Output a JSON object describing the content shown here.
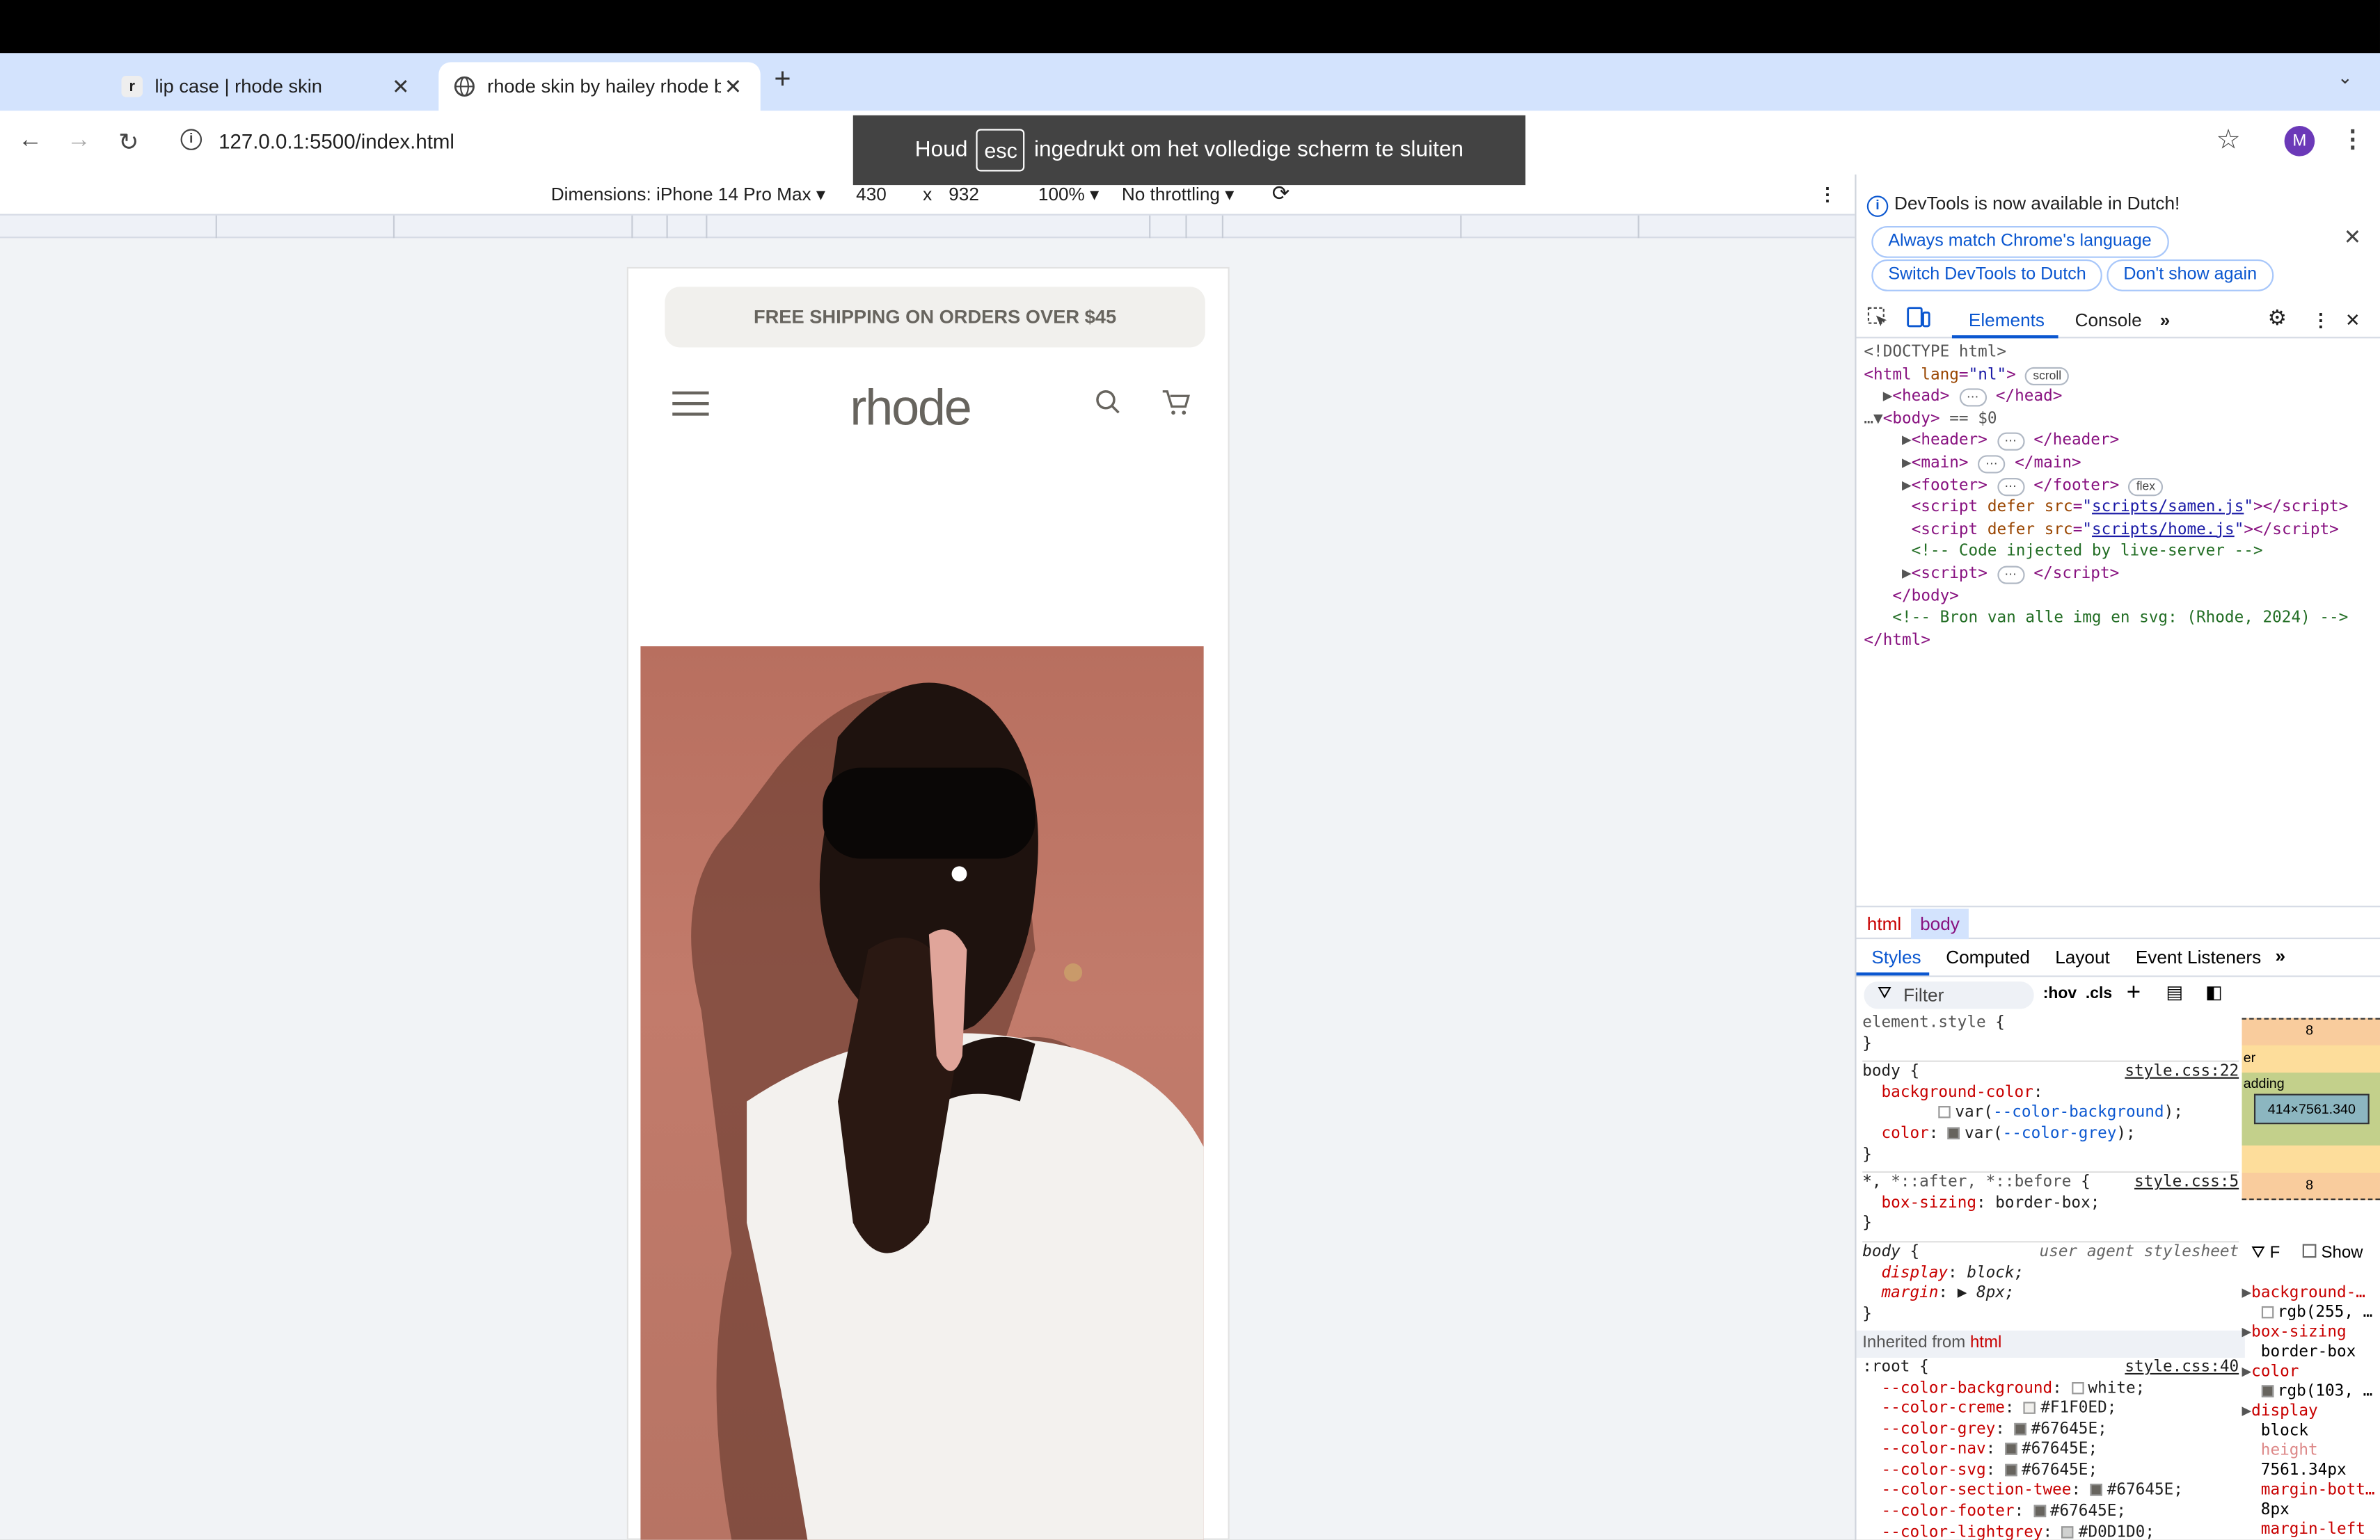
{
  "browser": {
    "tabs": [
      {
        "title": "lip case | rhode skin",
        "favicon": "r"
      },
      {
        "title": "rhode skin by hailey rhode bie",
        "favicon": "globe-icon"
      }
    ],
    "url": "127.0.0.1:5500/index.html",
    "avatar": "M",
    "fullscreen_notice": {
      "before": "Houd",
      "key": "esc",
      "after": "ingedrukt om het volledige scherm te sluiten"
    }
  },
  "device_toolbar": {
    "dimensions": "Dimensions: iPhone 14 Pro Max",
    "width": "430",
    "x": "x",
    "height": "932",
    "zoom": "100%",
    "throttling": "No throttling"
  },
  "page": {
    "shipping_banner": "FREE SHIPPING ON ORDERS OVER $45",
    "logo": "rhode"
  },
  "devtools": {
    "notice": "DevTools is now available in Dutch!",
    "btn_match": "Always match Chrome's language",
    "btn_switch": "Switch DevTools to Dutch",
    "btn_dont": "Don't show again",
    "tabs": [
      "Elements",
      "Console"
    ],
    "crumbs": [
      "html",
      "body"
    ],
    "style_tabs": [
      "Styles",
      "Computed",
      "Layout",
      "Event Listeners"
    ],
    "filter_placeholder": "Filter",
    "hov": ":hov",
    "cls": ".cls",
    "box_size": "414×7561.340",
    "box_margin": "8",
    "show": "Show",
    "inherited": "Inherited from",
    "inherited_tag": "html",
    "colors": {
      "background": "white",
      "creme": "#F1F0ED",
      "grey": "#67645E",
      "nav": "#67645E",
      "svg": "#67645E",
      "section_twee": "#67645E",
      "footer": "#67645E",
      "lightgrey": "#D0D1D0"
    }
  }
}
